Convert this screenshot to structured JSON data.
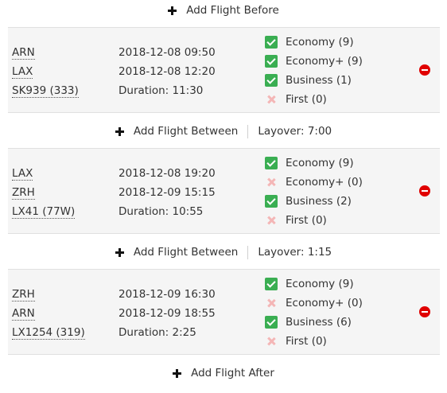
{
  "add_before_label": "Add Flight Before",
  "add_after_label": "Add Flight After",
  "add_between_label": "Add Flight Between",
  "flights": [
    {
      "from": "ARN",
      "to": "LAX",
      "flight": "SK939 (333)",
      "depart": "2018-12-08 09:50",
      "arrive": "2018-12-08 12:20",
      "duration": "Duration: 11:30",
      "classes": [
        {
          "label": "Economy (9)",
          "checked": true
        },
        {
          "label": "Economy+ (9)",
          "checked": true
        },
        {
          "label": "Business (1)",
          "checked": true
        },
        {
          "label": "First (0)",
          "checked": false
        }
      ]
    },
    {
      "from": "LAX",
      "to": "ZRH",
      "flight": "LX41 (77W)",
      "depart": "2018-12-08 19:20",
      "arrive": "2018-12-09 15:15",
      "duration": "Duration: 10:55",
      "classes": [
        {
          "label": "Economy (9)",
          "checked": true
        },
        {
          "label": "Economy+ (0)",
          "checked": false
        },
        {
          "label": "Business (2)",
          "checked": true
        },
        {
          "label": "First (0)",
          "checked": false
        }
      ]
    },
    {
      "from": "ZRH",
      "to": "ARN",
      "flight": "LX1254 (319)",
      "depart": "2018-12-09 16:30",
      "arrive": "2018-12-09 18:55",
      "duration": "Duration: 2:25",
      "classes": [
        {
          "label": "Economy (9)",
          "checked": true
        },
        {
          "label": "Economy+ (0)",
          "checked": false
        },
        {
          "label": "Business (6)",
          "checked": true
        },
        {
          "label": "First (0)",
          "checked": false
        }
      ]
    }
  ],
  "layovers": [
    "Layover: 7:00",
    "Layover: 1:15"
  ],
  "colors": {
    "checked": "#3aae52",
    "unchecked": "#f4b6b6",
    "remove": "#e00000",
    "card_bg": "#f5f5f5"
  },
  "icons": {
    "add": "plus-icon",
    "remove": "remove-circle-icon",
    "checked": "checkbox-checked-icon",
    "unchecked": "cross-icon"
  }
}
